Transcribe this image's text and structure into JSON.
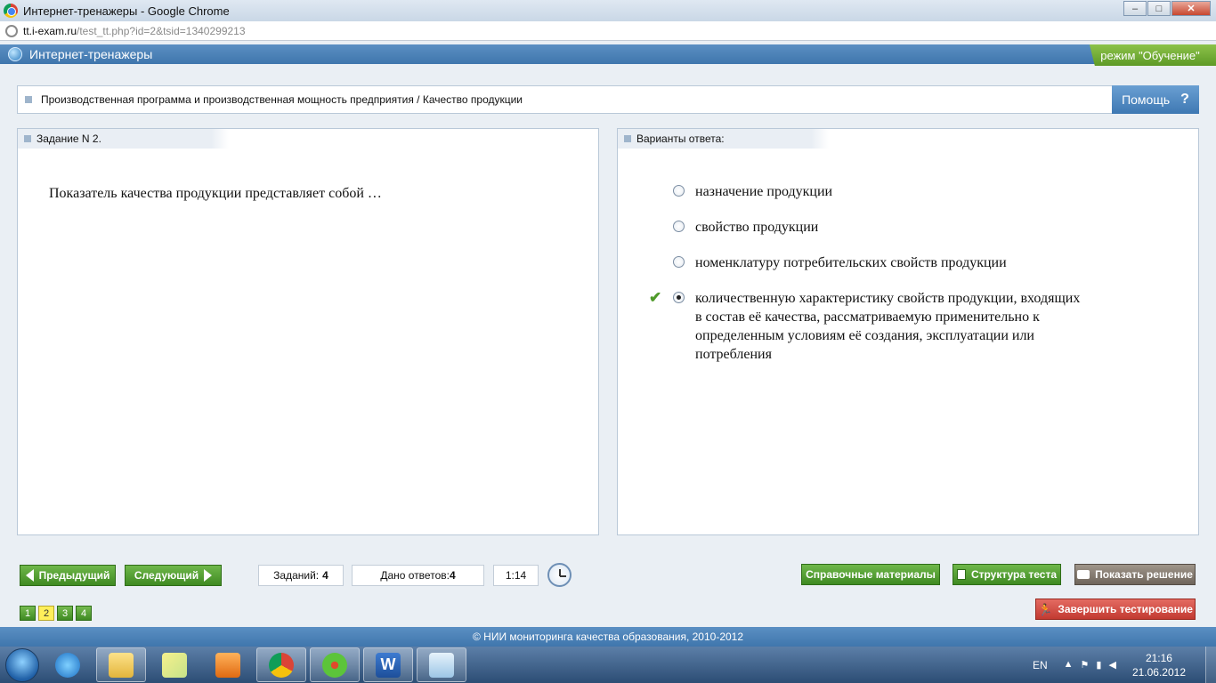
{
  "window": {
    "title": "Интернет-тренажеры - Google Chrome",
    "minimize": "–",
    "maximize": "□",
    "close": "✕"
  },
  "address": {
    "host": "tt.i-exam.ru",
    "path": "/test_tt.php?id=2&tsid=1340299213"
  },
  "header": {
    "app_title": "Интернет-тренажеры",
    "mode": "режим \"Обучение\""
  },
  "breadcrumb": {
    "text": "Производственная программа и производственная мощность предприятия / Качество продукции",
    "help_label": "Помощь",
    "help_icon": "?"
  },
  "task": {
    "heading": "Задание N 2.",
    "question": "Показатель качества продукции представляет собой …"
  },
  "answers_panel": {
    "heading": "Варианты ответа:",
    "options": [
      {
        "text": "назначение продукции",
        "selected": false
      },
      {
        "text": "свойство продукции",
        "selected": false
      },
      {
        "text": "номенклатуру потребительских свойств продукции",
        "selected": false
      },
      {
        "text": "количественную характеристику свойств продукции, входящих в состав её качества, рассматриваемую применительно к определенным условиям её создания, эксплуатации или потребления",
        "selected": true,
        "correct_mark": "✔"
      }
    ]
  },
  "nav": {
    "prev": "Предыдущий",
    "next": "Следующий",
    "tasks_label": "Заданий:",
    "tasks_value": "4",
    "answers_label": "Дано ответов:",
    "answers_value": "4",
    "timer": "1:14",
    "reference": "Справочные материалы",
    "structure": "Структура теста",
    "show_solution": "Показать решение",
    "finish": "Завершить тестирование",
    "pages": [
      "1",
      "2",
      "3",
      "4"
    ],
    "current_page": "2"
  },
  "footer": {
    "copyright": "© НИИ мониторинга качества образования, 2010-2012"
  },
  "taskbar": {
    "apps": [
      "internet-explorer-icon",
      "explorer-folder-icon",
      "sticky-notes-icon",
      "media-player-icon",
      "chrome-icon",
      "icq-icon",
      "word-icon",
      "notepad-icon"
    ],
    "lang": "EN",
    "time": "21:16",
    "date": "21.06.2012"
  },
  "colors": {
    "header_blue": "#4a82ba",
    "mode_green": "#6fa932",
    "nav_green": "#4f9a2a",
    "finish_red": "#d0473e"
  }
}
